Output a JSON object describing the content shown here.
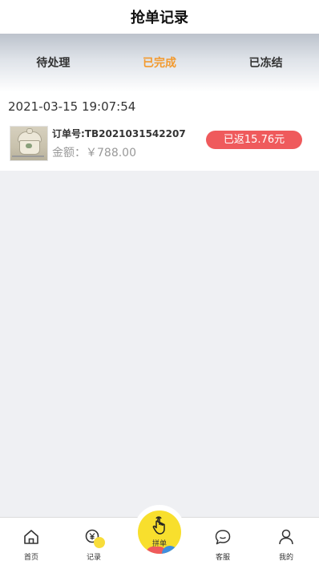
{
  "header": {
    "title": "抢单记录"
  },
  "tabs": [
    {
      "label": "待处理",
      "active": false
    },
    {
      "label": "已完成",
      "active": true
    },
    {
      "label": "已冻结",
      "active": false
    }
  ],
  "orders": [
    {
      "time": "2021-03-15 19:07:54",
      "order_no": "订单号:TB2021031542207",
      "amount": "金额：￥788.00",
      "rebate": "已返15.76元",
      "thumbnail_icon": "ceramic-jar-image"
    }
  ],
  "bottom_nav": {
    "home": {
      "label": "首页",
      "icon": "home-icon"
    },
    "records": {
      "label": "记录",
      "icon": "yen-search-icon"
    },
    "group": {
      "label": "拼单",
      "icon": "tap-hand-icon"
    },
    "service": {
      "label": "客服",
      "icon": "chat-bubble-icon"
    },
    "mine": {
      "label": "我的",
      "icon": "user-icon"
    }
  },
  "colors": {
    "accent": "#f39a2e",
    "rebate_badge": "#ef5a5c",
    "center_button": "#f8df2d"
  }
}
